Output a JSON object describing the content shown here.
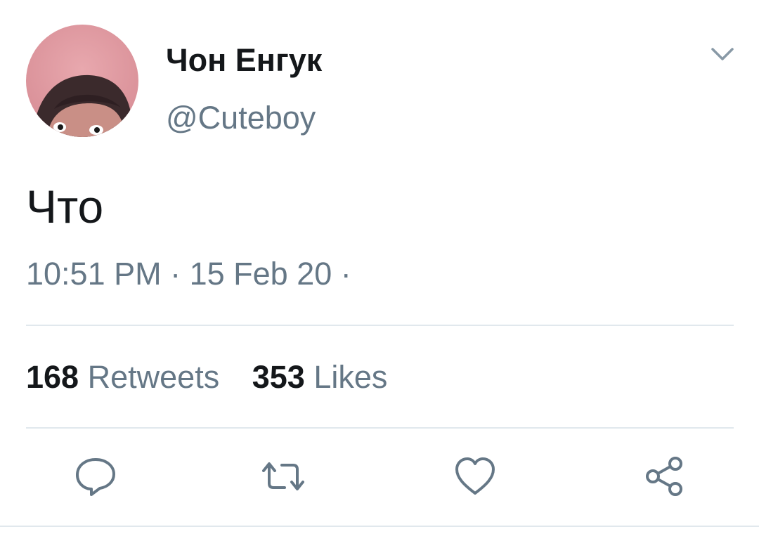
{
  "tweet": {
    "author": {
      "display_name": "Чон Енгук",
      "handle": "@Cuteboy"
    },
    "text": "Что",
    "meta": "10:51 PM · 15 Feb 20 ·",
    "stats": {
      "retweets_count": "168",
      "retweets_label": "Retweets",
      "likes_count": "353",
      "likes_label": "Likes"
    }
  },
  "icons": {
    "caret": "chevron-down-icon",
    "reply": "reply-icon",
    "retweet": "retweet-icon",
    "like": "heart-icon",
    "share": "share-icon"
  },
  "colors": {
    "text_primary": "#14171a",
    "text_secondary": "#657786",
    "divider": "#e1e8ed",
    "icon": "#657786"
  }
}
